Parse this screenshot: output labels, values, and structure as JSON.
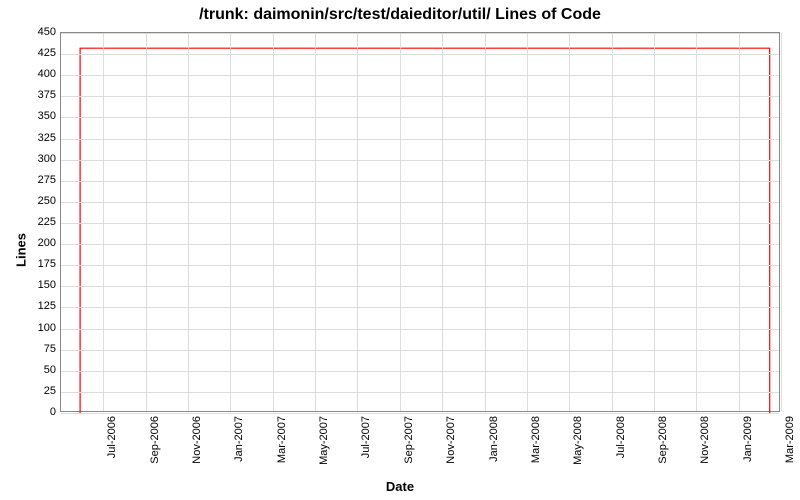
{
  "chart_data": {
    "type": "line",
    "title": "/trunk: daimonin/src/test/daieditor/util/ Lines of Code",
    "xlabel": "Date",
    "ylabel": "Lines",
    "ylim": [
      0,
      450
    ],
    "yticks": [
      0,
      25,
      50,
      75,
      100,
      125,
      150,
      175,
      200,
      225,
      250,
      275,
      300,
      325,
      350,
      375,
      400,
      425,
      450
    ],
    "xticks": [
      "Jul-2006",
      "Sep-2006",
      "Nov-2006",
      "Jan-2007",
      "Mar-2007",
      "May-2007",
      "Jul-2007",
      "Sep-2007",
      "Nov-2007",
      "Jan-2008",
      "Mar-2008",
      "May-2008",
      "Jul-2008",
      "Sep-2008",
      "Nov-2008",
      "Jan-2009",
      "Mar-2009"
    ],
    "series": [
      {
        "name": "Lines of Code",
        "color": "#ff0000",
        "points": [
          {
            "x": "2006-05-28",
            "y": 0
          },
          {
            "x": "2006-05-28",
            "y": 432
          },
          {
            "x": "2009-02-15",
            "y": 432
          },
          {
            "x": "2009-02-15",
            "y": 0
          }
        ]
      }
    ],
    "x_range_start": "2006-05-01",
    "x_range_end": "2009-03-01"
  }
}
